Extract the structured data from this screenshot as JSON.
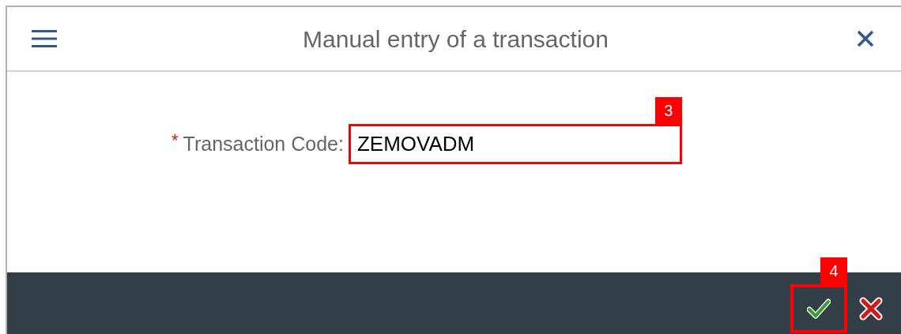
{
  "dialog": {
    "title": "Manual entry of a transaction"
  },
  "field": {
    "required_mark": "*",
    "label": "Transaction Code:",
    "required": true,
    "value": "ZEMOVADM",
    "callout": "3"
  },
  "footer": {
    "buttons": [
      {
        "kind": "accept",
        "callout": "4"
      },
      {
        "kind": "cancel"
      }
    ]
  }
}
